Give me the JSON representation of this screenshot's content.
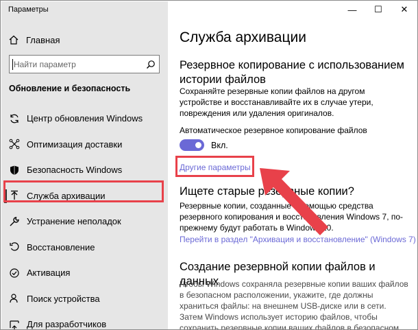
{
  "window": {
    "title": "Параметры",
    "controls": {
      "minimize": "—",
      "maximize": "☐",
      "close": "✕"
    }
  },
  "sidebar": {
    "home_label": "Главная",
    "search_placeholder": "Найти параметр",
    "section_title": "Обновление и безопасность",
    "items": [
      {
        "label": "Центр обновления Windows",
        "icon": "sync-icon"
      },
      {
        "label": "Оптимизация доставки",
        "icon": "delivery-icon"
      },
      {
        "label": "Безопасность Windows",
        "icon": "shield-icon"
      },
      {
        "label": "Служба архивации",
        "icon": "backup-arrow-icon",
        "active": true
      },
      {
        "label": "Устранение неполадок",
        "icon": "wrench-icon"
      },
      {
        "label": "Восстановление",
        "icon": "recovery-icon"
      },
      {
        "label": "Активация",
        "icon": "activation-check-icon"
      },
      {
        "label": "Поиск устройства",
        "icon": "person-locate-icon"
      },
      {
        "label": "Для разработчиков",
        "icon": "developer-icon"
      }
    ]
  },
  "main": {
    "title": "Служба архивации",
    "file_history": {
      "heading": "Резервное копирование с использованием истории файлов",
      "description": "Сохраняйте резервные копии файлов на другом устройстве и восстанавливайте их в случае утери, повреждения или удаления оригиналов.",
      "auto_label": "Автоматическое резервное копирование файлов",
      "toggle_state": "Вкл.",
      "more_options": "Другие параметры"
    },
    "old_backup": {
      "heading": "Ищете старые резервные копии?",
      "description": "Резервные копии, созданные с помощью средства резервного копирования и восстановления Windows 7, по-прежнему будут работать в Windows 10.",
      "link": "Перейти в раздел \"Архивация и восстановление\" (Windows 7)"
    },
    "create_backup": {
      "heading": "Создание резервной копии файлов и данных",
      "description": "Чтобы Windows сохраняла резервные копии ваших файлов в безопасном расположении, укажите, где должны храниться файлы: на внешнем USB-диске или в сети. Затем Windows использует историю файлов, чтобы сохранить резервные копии ваших файлов в безопасном расположении."
    }
  },
  "colors": {
    "accent": "#6b69d6",
    "highlight": "#e8414a",
    "sidebar_bg": "#e6e6e6"
  }
}
